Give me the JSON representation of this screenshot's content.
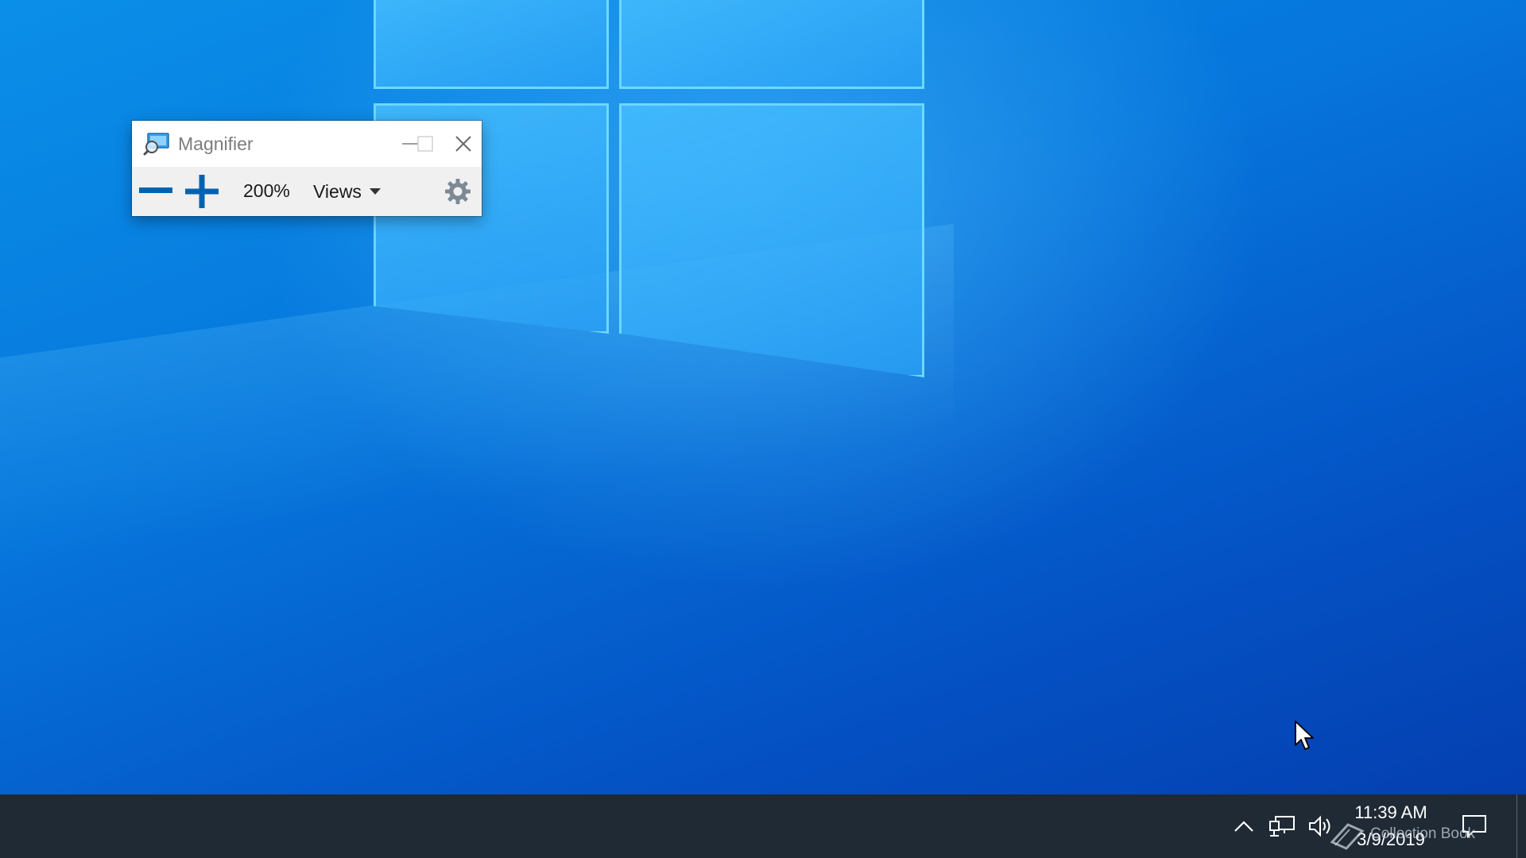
{
  "magnifier": {
    "title": "Magnifier",
    "zoom_level": "200%",
    "views_label": "Views"
  },
  "taskbar": {
    "time": "11:39 AM",
    "date": "3/9/2019"
  },
  "watermark": {
    "text": "Collection Book"
  },
  "icons": {
    "app": "magnifier-app-icon",
    "minimize": "minimize-icon",
    "maximize": "maximize-icon",
    "close": "close-icon",
    "zoom_out": "minus-icon",
    "zoom_in": "plus-icon",
    "views_caret": "caret-down-icon",
    "settings": "gear-icon",
    "chevron": "chevron-up-icon",
    "network": "network-icon",
    "volume": "volume-icon",
    "notifications": "notification-icon"
  },
  "colors": {
    "accent": "#0063b1",
    "taskbar": "#1f2a35",
    "desktop_top": "#0a8fe8",
    "desktop_bottom": "#043fb0"
  }
}
